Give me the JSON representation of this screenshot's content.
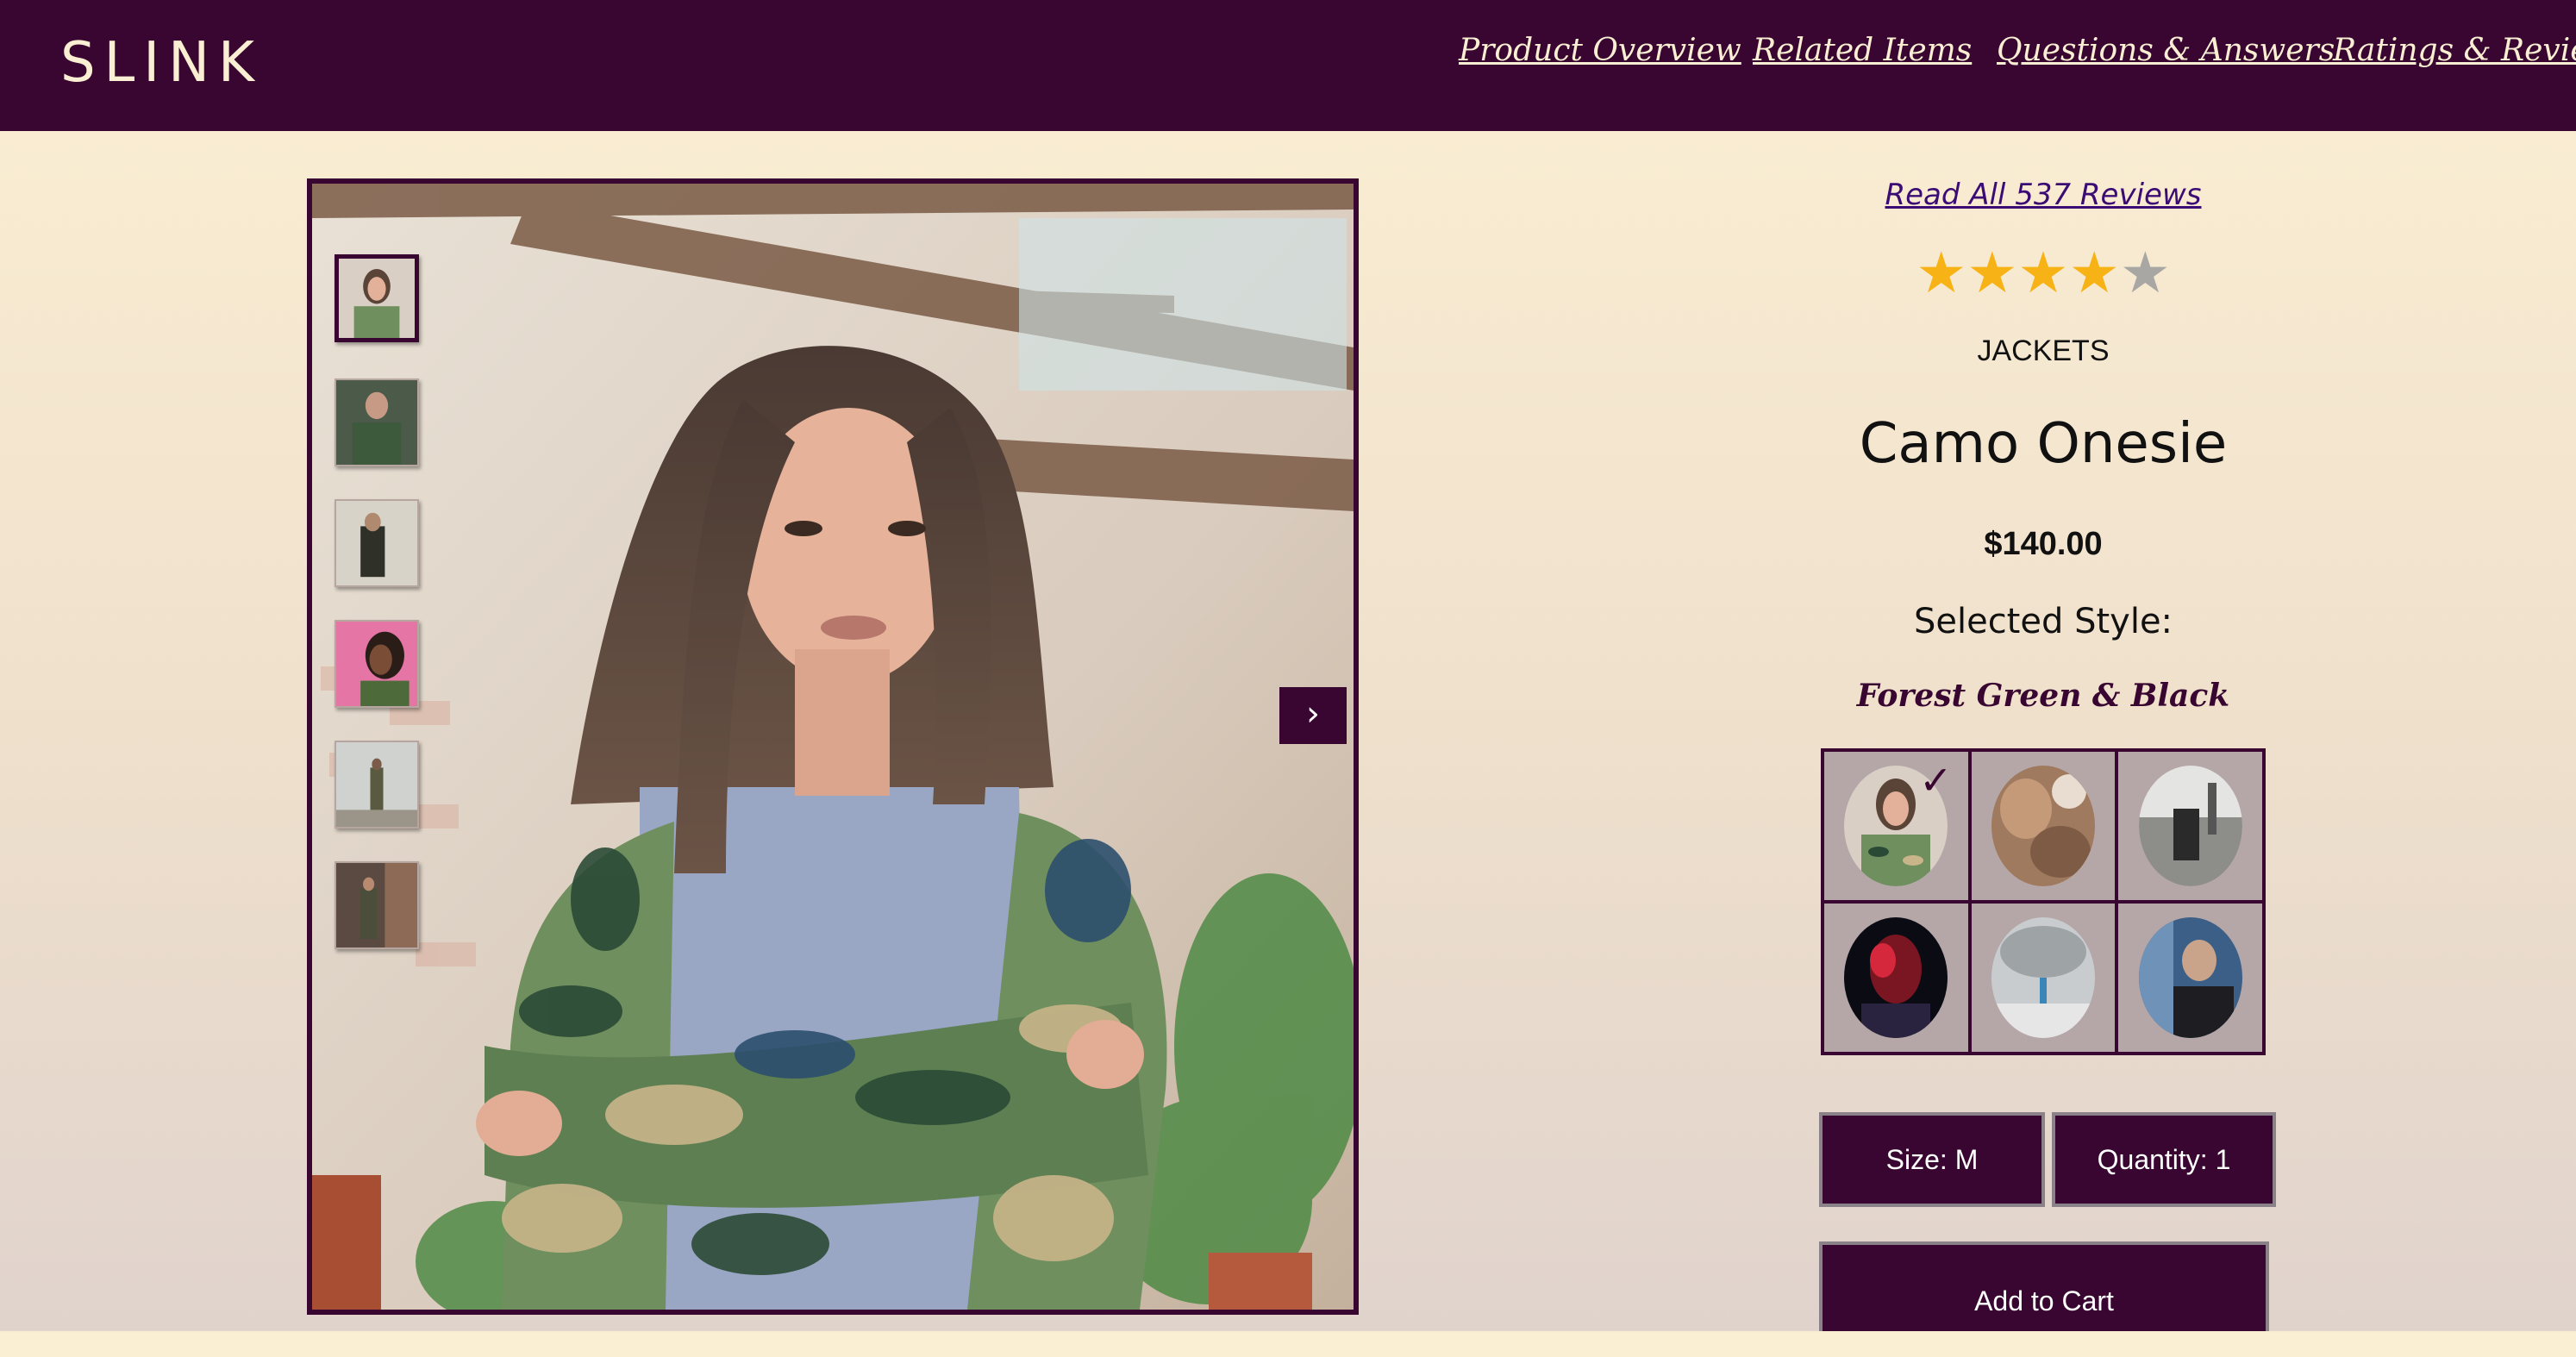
{
  "header": {
    "logo": "SLINK",
    "nav": [
      "Product Overview",
      "Related Items",
      "Questions & Answers",
      "Ratings & Reviews"
    ]
  },
  "gallery": {
    "thumbnail_count": 6,
    "selected_thumbnail": 0,
    "next_icon": "chevron-right-icon"
  },
  "product": {
    "reviews_link": "Read All 537 Reviews",
    "rating": 4,
    "rating_max": 5,
    "category": "JACKETS",
    "name": "Camo Onesie",
    "price": "$140.00",
    "selected_style_label": "Selected Style:",
    "selected_style_name": "Forest Green & Black",
    "style_count": 6,
    "selected_style_index": 0,
    "check_icon": "check-icon"
  },
  "controls": {
    "size_label": "Size: M",
    "quantity_label": "Quantity: 1",
    "add_to_cart_label": "Add to Cart"
  },
  "colors": {
    "brand": "#380631",
    "background": "#fbefd3",
    "star_on": "#f7b315",
    "star_off": "#a9a7a4",
    "link": "#3b0c74"
  }
}
